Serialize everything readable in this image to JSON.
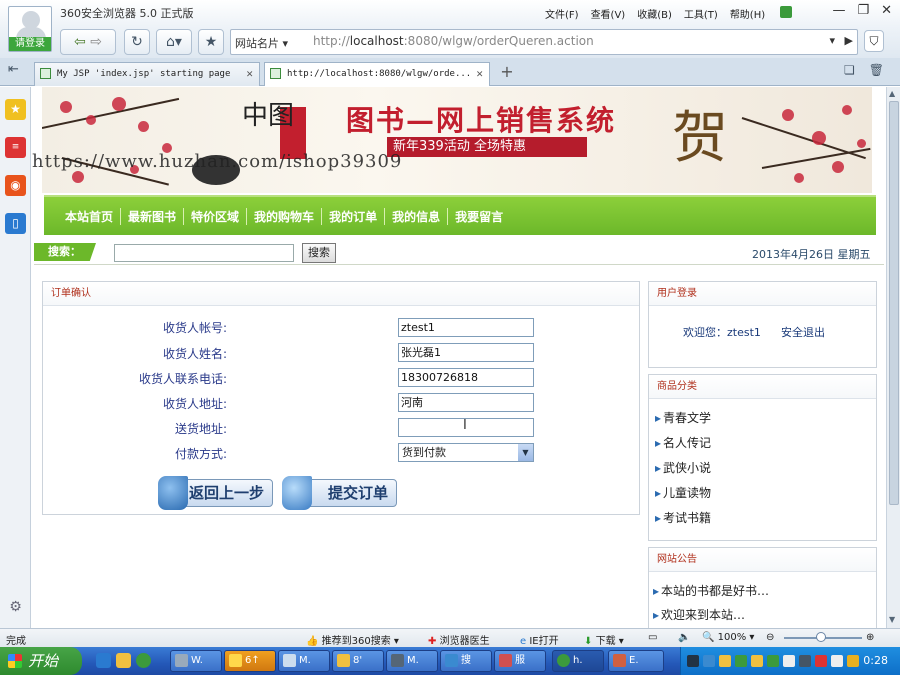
{
  "browser": {
    "login_label": "请登录",
    "app_title": "360安全浏览器 5.0 正式版",
    "menu": [
      "文件(F)",
      "查看(V)",
      "收藏(B)",
      "工具(T)",
      "帮助(H)"
    ],
    "window_controls": [
      "—",
      "❐",
      "✕"
    ],
    "address": {
      "site_dropdown": "网站名片",
      "url_prefix": "http://",
      "url_host": "localhost",
      "url_rest": ":8080/wlgw/orderQueren.action"
    },
    "tabs": [
      {
        "title": "My JSP 'index.jsp' starting page",
        "active": false
      },
      {
        "title": "http://localhost:8080/wlgw/orde...",
        "active": true
      }
    ]
  },
  "site": {
    "banner": {
      "brand_char": "中图",
      "slogan": "图书—网上销售系统",
      "promo": "新年339活动 全场特惠",
      "he_char": "贺"
    },
    "watermark": "https://www.huzhan.com/ishop39309",
    "nav_items": [
      "本站首页",
      "最新图书",
      "特价区域",
      "我的购物车",
      "我的订单",
      "我的信息",
      "我要留言"
    ],
    "search": {
      "label": "搜索：",
      "button": "搜索",
      "value": ""
    },
    "date": "2013年4月26日 星期五",
    "order": {
      "title": "订单确认",
      "fields": [
        {
          "label": "收货人帐号:",
          "value": "ztest1"
        },
        {
          "label": "收货人姓名:",
          "value": "张光磊1"
        },
        {
          "label": "收货人联系电话:",
          "value": "18300726818"
        },
        {
          "label": "收货人地址:",
          "value": "河南"
        },
        {
          "label": "送货地址:",
          "value": ""
        }
      ],
      "payment_label": "付款方式:",
      "payment_value": "货到付款",
      "back_button": "返回上一步",
      "submit_button": "提交订单"
    },
    "user_login": {
      "title": "用户登录",
      "welcome": "欢迎您：ztest1",
      "logout": "安全退出"
    },
    "categories": {
      "title": "商品分类",
      "items": [
        "青春文学",
        "名人传记",
        "武侠小说",
        "儿童读物",
        "考试书籍"
      ]
    },
    "notices": {
      "title": "网站公告",
      "items": [
        "本站的书都是好书…",
        "欢迎来到本站…"
      ]
    }
  },
  "statusbar": {
    "done": "完成",
    "recommend": "推荐到360搜索",
    "doctor": "浏览器医生",
    "ie_open": "IE打开",
    "download": "下载",
    "zoom": "100%"
  },
  "taskbar": {
    "start": "开始",
    "tasks": [
      "W.",
      "6↑",
      "M.",
      "8'",
      "M.",
      "搜",
      "服",
      "h.",
      "E."
    ],
    "clock": "0:28"
  },
  "colors": {
    "nav_green": "#6cb82a",
    "title_red": "#b0301c",
    "label_blue": "#2a3a8a"
  }
}
